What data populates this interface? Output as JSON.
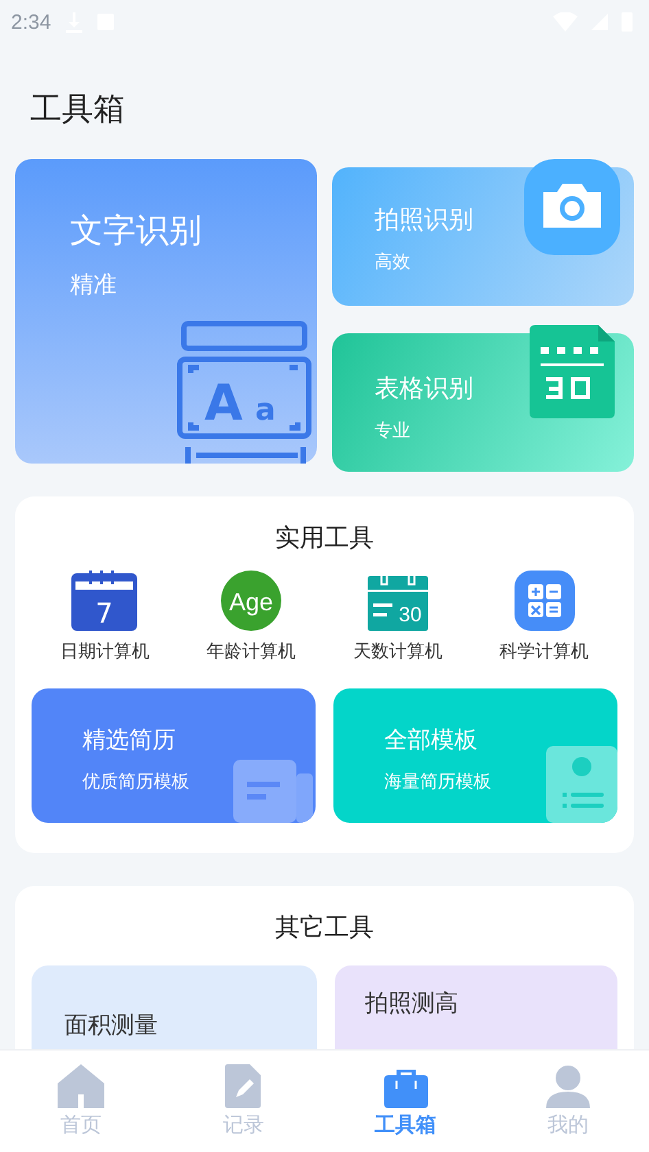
{
  "status_bar": {
    "time": "2:34"
  },
  "title": "工具箱",
  "feature_cards": [
    {
      "kind": "text",
      "title": "文字识别",
      "subtitle": "精准",
      "icon_letters": [
        "A",
        "a"
      ]
    },
    {
      "kind": "photo",
      "title": "拍照识别",
      "subtitle": "高效"
    },
    {
      "kind": "table",
      "title": "表格识别",
      "subtitle": "专业"
    }
  ],
  "practical_tools": {
    "heading": "实用工具",
    "tools": [
      {
        "kind": "date",
        "label": "日期计算机",
        "icon_text": "7"
      },
      {
        "kind": "age",
        "label": "年龄计算机",
        "icon_text": "Age"
      },
      {
        "kind": "days",
        "label": "天数计算机",
        "icon_text": "30"
      },
      {
        "kind": "science",
        "label": "科学计算机"
      }
    ],
    "resume_cards": [
      {
        "kind": "selected",
        "title": "精选简历",
        "subtitle": "优质简历模板"
      },
      {
        "kind": "all",
        "title": "全部模板",
        "subtitle": "海量简历模板"
      }
    ]
  },
  "other_tools": {
    "heading": "其它工具",
    "cards": [
      {
        "kind": "area",
        "title": "面积测量"
      },
      {
        "kind": "height",
        "title": "拍照测高"
      }
    ]
  },
  "tab_bar": [
    {
      "kind": "home",
      "label": "首页",
      "selected": false
    },
    {
      "kind": "record",
      "label": "记录",
      "selected": false
    },
    {
      "kind": "toolbox",
      "label": "工具箱",
      "selected": true
    },
    {
      "kind": "me",
      "label": "我的",
      "selected": false
    }
  ]
}
